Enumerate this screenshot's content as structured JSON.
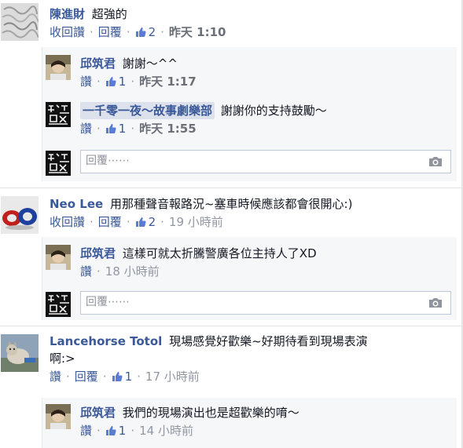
{
  "colors": {
    "link": "#3b5998",
    "meta_gray": "#9197a3",
    "reply_bg": "#f6f7f8",
    "border": "#bdc7d8"
  },
  "icons": {
    "like": "thumbs-up-icon",
    "camera": "camera-icon"
  },
  "threads": [
    {
      "author": "陳進財",
      "text": "超強的",
      "actions": {
        "unlike": "收回讚",
        "reply": "回覆"
      },
      "likes": "2",
      "time": "昨天 1:10",
      "replies": [
        {
          "author": "邱筑君",
          "text": "謝謝～^^",
          "actions": {
            "unlike": "讚"
          },
          "likes": "1",
          "time": "昨天 1:17"
        },
        {
          "author": "一千零一夜～故事劇樂部",
          "text": "謝謝你的支持鼓勵～",
          "actions": {
            "unlike": "讚"
          },
          "likes": "1",
          "time": "昨天 1:55"
        }
      ],
      "reply_placeholder": "回覆⋯⋯"
    },
    {
      "author": "Neo Lee",
      "text": "用那種聲音報路況~塞車時候應該都會很開心:)",
      "actions": {
        "unlike": "收回讚",
        "reply": "回覆"
      },
      "likes": "2",
      "time": "19 小時前",
      "replies": [
        {
          "author": "邱筑君",
          "text": "這樣可就太折騰警廣各位主持人了XD",
          "actions": {
            "like": "讚"
          },
          "time": "18 小時前"
        }
      ],
      "reply_placeholder": "回覆⋯⋯"
    },
    {
      "author": "Lancehorse Totol",
      "text_line1": "現場感覺好歡樂~好期待看到現場表演",
      "text_line2": "啊:>",
      "actions": {
        "like": "讚",
        "reply": "回覆"
      },
      "likes": "1",
      "time": "17 小時前",
      "replies": [
        {
          "author": "邱筑君",
          "text": "我們的現場演出也是超歡樂的唷～",
          "actions": {
            "like": "讚"
          },
          "likes": "1",
          "time": "14 小時前"
        }
      ]
    }
  ]
}
